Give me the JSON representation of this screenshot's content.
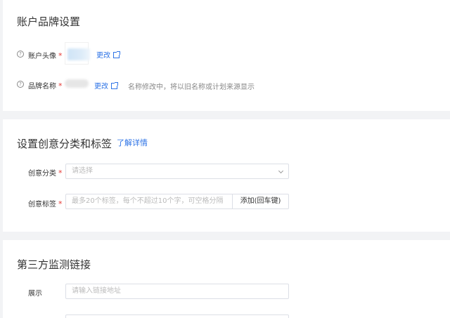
{
  "brand": {
    "title": "账户品牌设置",
    "avatar_label": "账户头像",
    "avatar_edit": "更改",
    "name_label": "品牌名称",
    "name_edit": "更改",
    "name_hint": "名称修改中，将以旧名称或计划来源显示",
    "required_mark": "*",
    "help_glyph": "?"
  },
  "creative": {
    "title": "设置创意分类和标签",
    "help_link": "了解详情",
    "category_label": "创意分类",
    "category_placeholder": "请选择",
    "tags_label": "创意标签",
    "tags_placeholder": "最多20个标签，每个不超过10个字，可空格分隔",
    "add_button": "添加(回车键)",
    "required_mark": "*"
  },
  "monitor": {
    "title": "第三方监测链接",
    "display_label": "展示",
    "display_placeholder": "请输入链接地址"
  },
  "colors": {
    "link": "#2d73e6",
    "required": "#e53935",
    "background": "#f2f3f5"
  }
}
